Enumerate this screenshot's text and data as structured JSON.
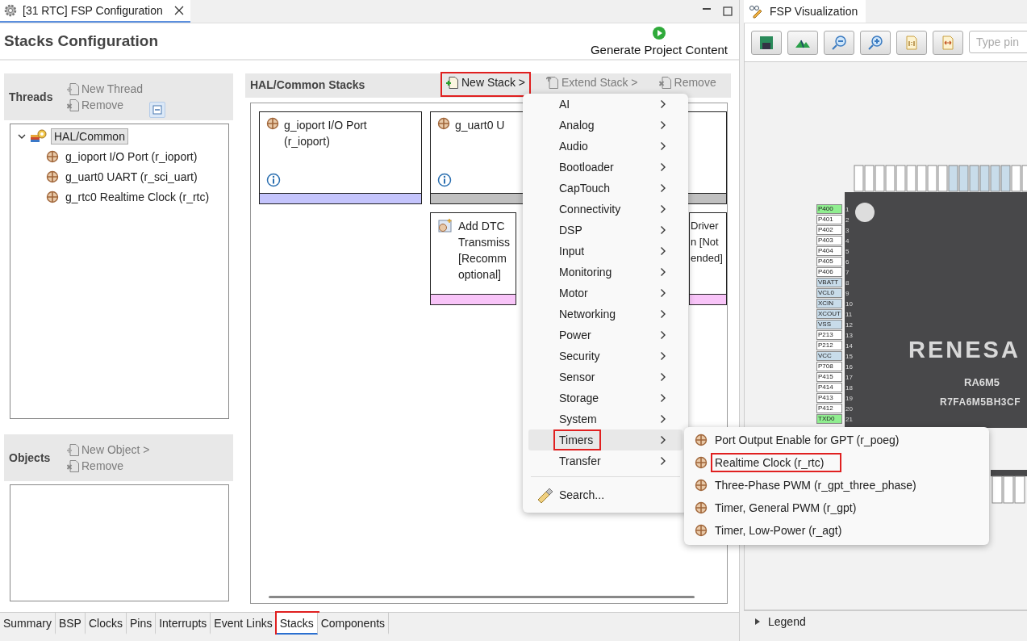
{
  "editor_tab": {
    "title": "[31 RTC] FSP Configuration",
    "selected": true
  },
  "page_title": "Stacks Configuration",
  "generate_button": "Generate Project Content",
  "threads": {
    "title": "Threads",
    "actions": [
      {
        "label": "New Thread",
        "kind": "add",
        "disabled": true
      },
      {
        "label": "Remove",
        "kind": "remove",
        "disabled": true
      }
    ],
    "tree": [
      {
        "label": "HAL/Common",
        "expanded": true,
        "selected": true,
        "children": [
          {
            "label": "g_ioport I/O Port (r_ioport)",
            "selected": false
          },
          {
            "label": "g_uart0 UART (r_sci_uart)",
            "selected": false
          },
          {
            "label": "g_rtc0 Realtime Clock (r_rtc)",
            "selected": false
          }
        ]
      }
    ]
  },
  "objects": {
    "title": "Objects",
    "actions": [
      {
        "label": "New Object >",
        "kind": "add",
        "disabled": true
      },
      {
        "label": "Remove",
        "kind": "remove",
        "disabled": true
      }
    ]
  },
  "stacks": {
    "title": "HAL/Common Stacks",
    "actions": [
      {
        "label": "New Stack >",
        "kind": "add",
        "disabled": false,
        "highlighted": true
      },
      {
        "label": "Extend Stack >",
        "kind": "extend",
        "disabled": true,
        "highlighted": false
      },
      {
        "label": "Remove",
        "kind": "remove",
        "disabled": true,
        "highlighted": false
      }
    ],
    "cards": [
      {
        "title": "g_ioport I/O Port\n(r_ioport)",
        "kind": "module",
        "info": true,
        "color": "#c4c4fc"
      },
      {
        "title": "g_uart0 U",
        "kind": "module",
        "info": true,
        "color": "#c0c0c0",
        "children": [
          {
            "title": "Add DTC\nTransmiss\n[Recomm\noptional]",
            "kind": "add",
            "info": false,
            "color": "#f8c4f8"
          },
          {
            "title": "Driver\nn [Not\nended]",
            "kind": "plain",
            "info": false,
            "color": "#f8c4f8"
          }
        ]
      }
    ]
  },
  "menu": {
    "items": [
      {
        "label": "AI",
        "kind": "submenu",
        "selected": false,
        "highlighted": false
      },
      {
        "label": "Analog",
        "kind": "submenu",
        "selected": false,
        "highlighted": false
      },
      {
        "label": "Audio",
        "kind": "submenu",
        "selected": false,
        "highlighted": false
      },
      {
        "label": "Bootloader",
        "kind": "submenu",
        "selected": false,
        "highlighted": false
      },
      {
        "label": "CapTouch",
        "kind": "submenu",
        "selected": false,
        "highlighted": false
      },
      {
        "label": "Connectivity",
        "kind": "submenu",
        "selected": false,
        "highlighted": false
      },
      {
        "label": "DSP",
        "kind": "submenu",
        "selected": false,
        "highlighted": false
      },
      {
        "label": "Input",
        "kind": "submenu",
        "selected": false,
        "highlighted": false
      },
      {
        "label": "Monitoring",
        "kind": "submenu",
        "selected": false,
        "highlighted": false
      },
      {
        "label": "Motor",
        "kind": "submenu",
        "selected": false,
        "highlighted": false
      },
      {
        "label": "Networking",
        "kind": "submenu",
        "selected": false,
        "highlighted": false
      },
      {
        "label": "Power",
        "kind": "submenu",
        "selected": false,
        "highlighted": false
      },
      {
        "label": "Security",
        "kind": "submenu",
        "selected": false,
        "highlighted": false
      },
      {
        "label": "Sensor",
        "kind": "submenu",
        "selected": false,
        "highlighted": false
      },
      {
        "label": "Storage",
        "kind": "submenu",
        "selected": false,
        "highlighted": false
      },
      {
        "label": "System",
        "kind": "submenu",
        "selected": false,
        "highlighted": false
      },
      {
        "label": "Timers",
        "kind": "submenu",
        "selected": true,
        "highlighted": true
      },
      {
        "label": "Transfer",
        "kind": "submenu",
        "selected": false,
        "highlighted": false
      },
      {
        "label": "Search...",
        "kind": "search",
        "selected": false,
        "highlighted": false
      }
    ]
  },
  "submenu": {
    "items": [
      {
        "label": "Port Output Enable for GPT (r_poeg)",
        "highlighted": false
      },
      {
        "label": "Realtime Clock (r_rtc)",
        "highlighted": true
      },
      {
        "label": "Three-Phase PWM (r_gpt_three_phase)",
        "highlighted": false
      },
      {
        "label": "Timer, General PWM (r_gpt)",
        "highlighted": false
      },
      {
        "label": "Timer, Low-Power (r_agt)",
        "highlighted": false
      }
    ]
  },
  "bottom_tabs": [
    {
      "label": "Summary",
      "selected": false,
      "highlighted": false
    },
    {
      "label": "BSP",
      "selected": false,
      "highlighted": false
    },
    {
      "label": "Clocks",
      "selected": false,
      "highlighted": false
    },
    {
      "label": "Pins",
      "selected": false,
      "highlighted": false
    },
    {
      "label": "Interrupts",
      "selected": false,
      "highlighted": false
    },
    {
      "label": "Event Links",
      "selected": false,
      "highlighted": false
    },
    {
      "label": "Stacks",
      "selected": true,
      "highlighted": true
    },
    {
      "label": "Components",
      "selected": false,
      "highlighted": false
    }
  ],
  "visualization": {
    "tab": "FSP Visualization",
    "search": {
      "placeholder": "Type pin"
    },
    "chip": {
      "logo": "RENESA",
      "model": "RA6M5",
      "part": "R7FA6M5BH3CF",
      "left_pins": [
        {
          "label": "P400",
          "number": "1",
          "color": "#90ee90"
        },
        {
          "label": "P401",
          "number": "2",
          "color": "#ffffff"
        },
        {
          "label": "P402",
          "number": "3",
          "color": "#ffffff"
        },
        {
          "label": "P403",
          "number": "4",
          "color": "#ffffff"
        },
        {
          "label": "P404",
          "number": "5",
          "color": "#ffffff"
        },
        {
          "label": "P405",
          "number": "6",
          "color": "#ffffff"
        },
        {
          "label": "P406",
          "number": "7",
          "color": "#ffffff"
        },
        {
          "label": "VBATT",
          "number": "8",
          "color": "#c8dcea"
        },
        {
          "label": "VCL0",
          "number": "9",
          "color": "#c8dcea"
        },
        {
          "label": "XCIN",
          "number": "10",
          "color": "#c8dcea"
        },
        {
          "label": "XCOUT",
          "number": "11",
          "color": "#c8dcea"
        },
        {
          "label": "VSS",
          "number": "12",
          "color": "#c8dcea"
        },
        {
          "label": "P213",
          "number": "13",
          "color": "#ffffff"
        },
        {
          "label": "P212",
          "number": "14",
          "color": "#ffffff"
        },
        {
          "label": "VCC",
          "number": "15",
          "color": "#c8dcea"
        },
        {
          "label": "P708",
          "number": "16",
          "color": "#ffffff"
        },
        {
          "label": "P415",
          "number": "17",
          "color": "#ffffff"
        },
        {
          "label": "P414",
          "number": "18",
          "color": "#ffffff"
        },
        {
          "label": "P413",
          "number": "19",
          "color": "#ffffff"
        },
        {
          "label": "P412",
          "number": "20",
          "color": "#ffffff"
        },
        {
          "label": "TXD0",
          "number": "21",
          "color": "#90ee90"
        }
      ]
    },
    "legend": {
      "label": "Legend",
      "expanded": false
    }
  }
}
